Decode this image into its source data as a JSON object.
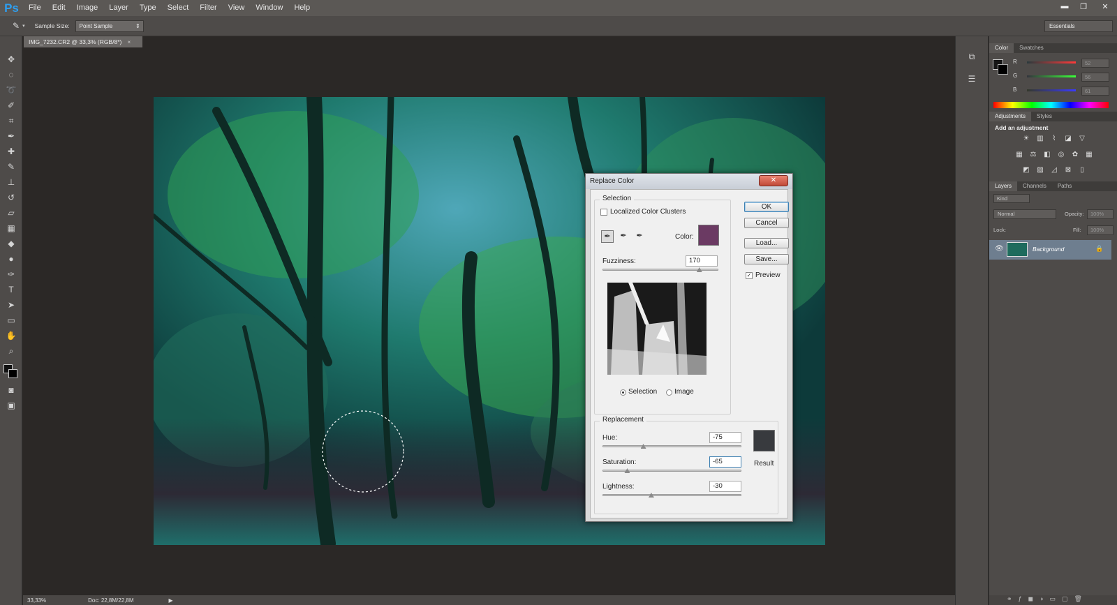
{
  "app": {
    "logo": "Ps"
  },
  "menu": [
    "File",
    "Edit",
    "Image",
    "Layer",
    "Type",
    "Select",
    "Filter",
    "View",
    "Window",
    "Help"
  ],
  "window_controls": {
    "minimize": "▬",
    "restore": "❐",
    "close": "✕"
  },
  "options": {
    "label": "Sample Size:",
    "value": "Point Sample",
    "workspace": "Essentials"
  },
  "document": {
    "tab": "IMG_7232.CR2 @ 33,3% (RGB/8*)",
    "close": "×"
  },
  "status": {
    "zoom": "33,33%",
    "doc": "Doc: 22,8M/22,8M"
  },
  "color_panel": {
    "tabs": [
      "Color",
      "Swatches"
    ],
    "channels": [
      {
        "name": "R",
        "value": "52"
      },
      {
        "name": "G",
        "value": "56"
      },
      {
        "name": "B",
        "value": "61"
      }
    ]
  },
  "adjustments": {
    "tabs": [
      "Adjustments",
      "Styles"
    ],
    "title": "Add an adjustment"
  },
  "layers": {
    "tabs": [
      "Layers",
      "Channels",
      "Paths"
    ],
    "kind": "Kind",
    "blend": "Normal",
    "opacity_label": "Opacity:",
    "opacity": "100%",
    "lock_label": "Lock:",
    "fill_label": "Fill:",
    "fill": "100%",
    "layer_name": "Background"
  },
  "dialog": {
    "title": "Replace Color",
    "close": "✕",
    "selection_group": "Selection",
    "localized": "Localized Color Clusters",
    "color_label": "Color:",
    "fuzziness_label": "Fuzziness:",
    "fuzziness": "170",
    "fuzziness_level": 0.84,
    "radio_selection": "Selection",
    "radio_image": "Image",
    "replacement_group": "Replacement",
    "hue_label": "Hue:",
    "hue": "-75",
    "hue_level": 0.292,
    "saturation_label": "Saturation:",
    "saturation": "-65",
    "saturation_level": 0.175,
    "lightness_label": "Lightness:",
    "lightness": "-30",
    "lightness_level": 0.35,
    "result_label": "Result",
    "ok": "OK",
    "cancel": "Cancel",
    "load": "Load...",
    "save": "Save...",
    "preview": "Preview",
    "sample_color": "#6b3a63",
    "result_color": "#383a3e"
  }
}
